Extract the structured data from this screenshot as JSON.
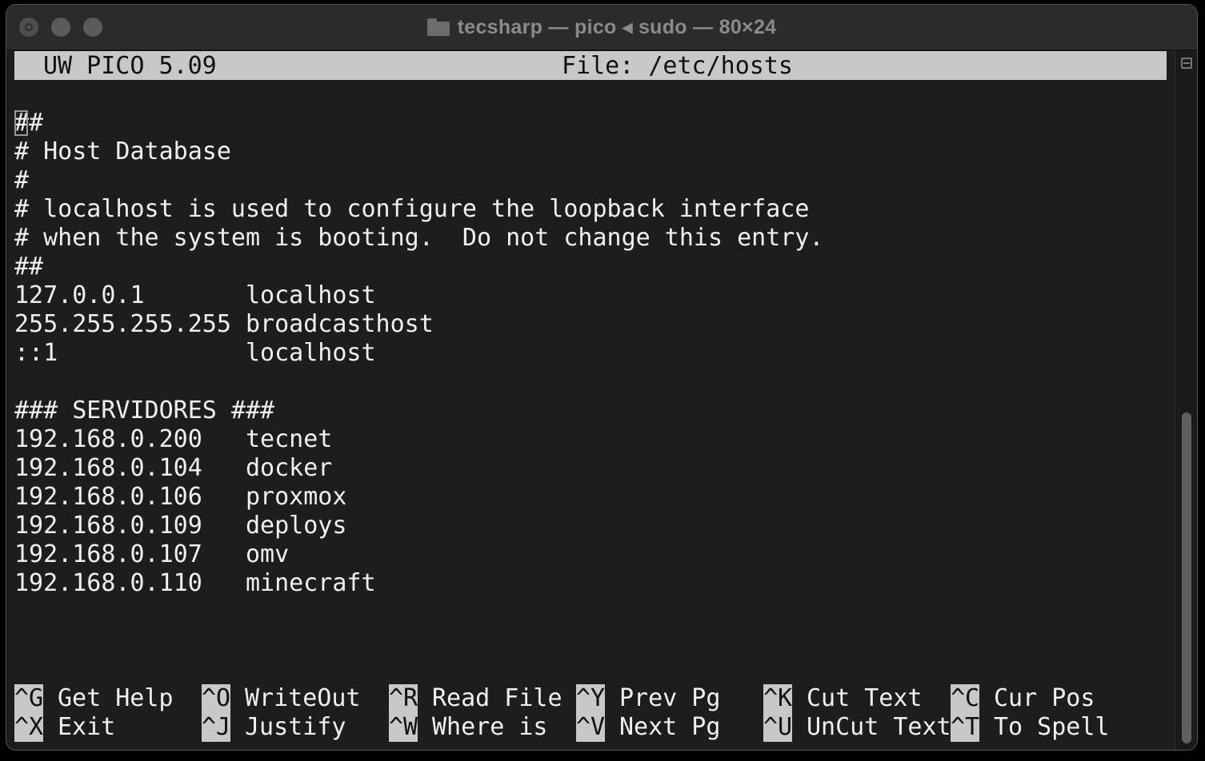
{
  "window": {
    "title": "tecsharp — pico ◂ sudo — 80×24"
  },
  "editor": {
    "name": "UW PICO 5.09",
    "file_label": "File: /etc/hosts"
  },
  "content_lines": [
    "##",
    "# Host Database",
    "#",
    "# localhost is used to configure the loopback interface",
    "# when the system is booting.  Do not change this entry.",
    "##",
    "127.0.0.1       localhost",
    "255.255.255.255 broadcasthost",
    "::1             localhost",
    "",
    "### SERVIDORES ###",
    "192.168.0.200   tecnet",
    "192.168.0.104   docker",
    "192.168.0.106   proxmox",
    "192.168.0.109   deploys",
    "192.168.0.107   omv",
    "192.168.0.110   minecraft"
  ],
  "shortcuts_row1": [
    {
      "key": "^G",
      "label": "Get Help"
    },
    {
      "key": "^O",
      "label": "WriteOut"
    },
    {
      "key": "^R",
      "label": "Read File"
    },
    {
      "key": "^Y",
      "label": "Prev Pg"
    },
    {
      "key": "^K",
      "label": "Cut Text"
    },
    {
      "key": "^C",
      "label": "Cur Pos"
    }
  ],
  "shortcuts_row2": [
    {
      "key": "^X",
      "label": "Exit"
    },
    {
      "key": "^J",
      "label": "Justify"
    },
    {
      "key": "^W",
      "label": "Where is"
    },
    {
      "key": "^V",
      "label": "Next Pg"
    },
    {
      "key": "^U",
      "label": "UnCut Text"
    },
    {
      "key": "^T",
      "label": "To Spell"
    }
  ],
  "icons": {
    "folder": "folder-icon",
    "scrollbar_toggle": "scrollbar-toggle-icon"
  }
}
